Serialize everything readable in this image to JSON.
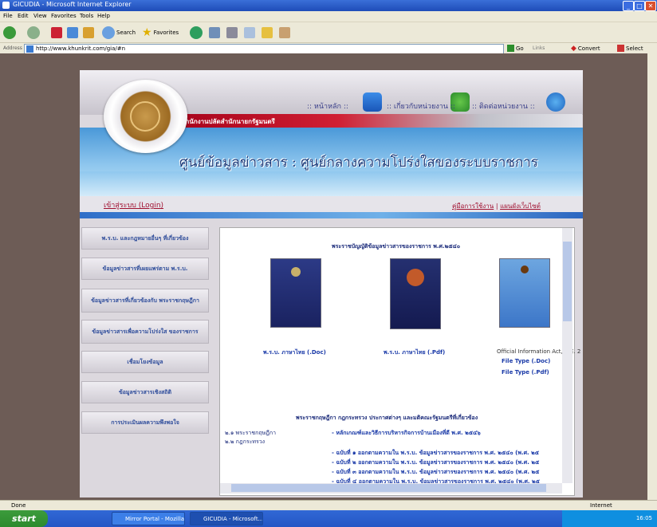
{
  "window": {
    "title": "GICUDIA - Microsoft Internet Explorer"
  },
  "menu": [
    "File",
    "Edit",
    "View",
    "Favorites",
    "Tools",
    "Help"
  ],
  "toolbar": {
    "search_label": "Search",
    "favorites_label": "Favorites",
    "go_label": "Go",
    "links_label": "Links",
    "convert_label": "Convert",
    "select_label": "Select"
  },
  "address": {
    "label": "Address",
    "url": "http://www.khunkrit.com/gia/#n"
  },
  "site": {
    "nav": {
      "home": ":: หน้าหลัก ::",
      "about": ":: เกี่ยวกับหน่วยงาน ::",
      "contact": ":: ติดต่อหน่วยงาน ::"
    },
    "agency": "สำนักงานปลัดสำนักนายกรัฐมนตรี",
    "banner": "ศูนย์ข้อมูลข่าวสาร : ศูนย์กลางความโปร่งใสของระบบราชการ",
    "login": "เข้าสู่ระบบ (Login)",
    "manual": "คู่มือการใช้งาน",
    "separator": "|",
    "sitemap": "แผนผังเว็บไซต์"
  },
  "left_menu": [
    "พ.ร.บ. และกฎหมายอื่นๆ ที่เกี่ยวข้อง",
    "ข้อมูลข่าวสารที่เผยแพร่ตาม พ.ร.บ.",
    "ข้อมูลข่าวสารที่เกี่ยวข้องกับ พระราชกฤษฎีกา",
    "ข้อมูลข่าวสารเพื่อความโปร่งใส ของราชการ",
    "เชื่อมโยงข้อมูล",
    "ข้อมูลข่าวสารเชิงสถิติ",
    "การประเมินผลความพึงพอใจ"
  ],
  "content": {
    "heading1": "พระราชบัญญัติข้อมูลข่าวสารของราชการ พ.ศ.๒๕๔๐",
    "doc_th": "พ.ร.บ. ภาษาไทย (.Doc)",
    "pdf_th": "พ.ร.บ. ภาษาไทย (.Pdf)",
    "eng_title": "Official Information Act, B.E. 2",
    "file_doc": "File Type (.Doc)",
    "file_pdf": "File Type (.Pdf)",
    "heading2": "พระราชกฤษฎีกา กฎกระทรวง ประกาศต่างๆ และมติคณะรัฐมนตรีที่เกี่ยวข้อง",
    "left_col": [
      "๒.๑ พระราชกฤษฎีกา",
      "๒.๒ กฎกระทรวง"
    ],
    "right_col": [
      "- หลักเกณฑ์และวิธีการบริหารกิจการบ้านเมืองที่ดี พ.ศ. ๒๕๔๖",
      "- ฉบับที่ ๑ ออกตามความใน พ.ร.บ. ข้อมูลข่าวสารของราชการ พ.ศ. ๒๕๔๐ (พ.ศ. ๒๕",
      "- ฉบับที่ ๒ ออกตามความใน พ.ร.บ. ข้อมูลข่าวสารของราชการ พ.ศ. ๒๕๔๐ (พ.ศ. ๒๕",
      "- ฉบับที่ ๓ ออกตามความใน พ.ร.บ. ข้อมูลข่าวสารของราชการ พ.ศ. ๒๕๔๐ (พ.ศ. ๒๕",
      "- ฉบับที่ ๔ ออกตามความใน พ.ร.บ. ข้อมูลข่าวสารของราชการ พ.ศ. ๒๕๔๐ (พ.ศ. ๒๕"
    ]
  },
  "status": {
    "left": "Done",
    "right": "Internet"
  },
  "taskbar": {
    "start": "start",
    "tasks": [
      "Mirror Portal - Mozilla...",
      "GICUDIA - Microsoft..."
    ],
    "clock": "16:05"
  },
  "colors": {
    "red_bar": "#c0102a",
    "link": "#a01030",
    "menu_text": "#2f4d9b"
  }
}
